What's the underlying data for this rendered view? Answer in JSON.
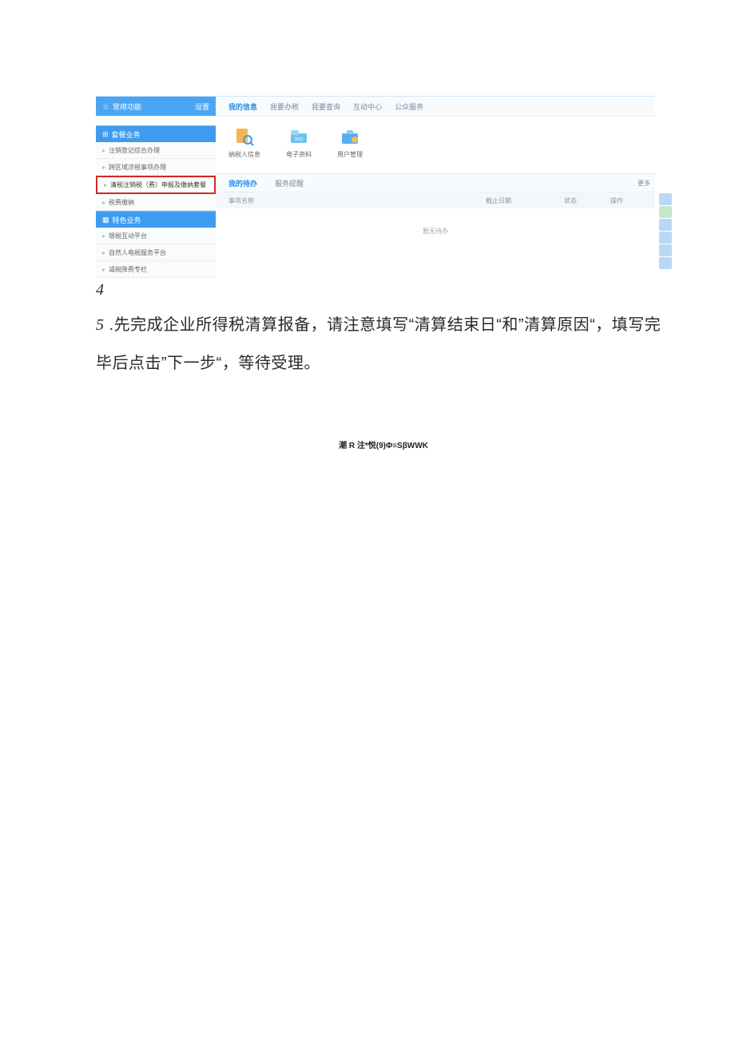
{
  "sidebar": {
    "fav_header": "常用功能",
    "fav_action": "设置",
    "sections": [
      {
        "title": "套餐业务",
        "items": [
          {
            "label": "注销登记综合办理"
          },
          {
            "label": "跨区域涉税事项办理"
          },
          {
            "label": "清税注销税（费）申报及缴纳套餐",
            "highlight": true
          },
          {
            "label": "税费缴纳"
          }
        ]
      },
      {
        "title": "特色业务",
        "items": [
          {
            "label": "银税互动平台"
          },
          {
            "label": "自然人电税服务平台"
          },
          {
            "label": "减税降费专栏"
          }
        ]
      }
    ]
  },
  "tabs": [
    "我的信息",
    "我要办税",
    "我要查询",
    "互动中心",
    "公众服务"
  ],
  "active_tab": 0,
  "info_cards": [
    {
      "label": "纳税人信息"
    },
    {
      "label": "电子资料"
    },
    {
      "label": "用户管理"
    }
  ],
  "subtabs": [
    "我的待办",
    "服务提醒"
  ],
  "active_subtab": 0,
  "subtabs_more": "更多",
  "table": {
    "cols": [
      "事项名称",
      "截止日期",
      "状态",
      "操作"
    ],
    "empty": "暂无待办"
  },
  "doc": {
    "step4": "4",
    "step5_num": "5",
    "step5_text": " .先完成企业所得税清算报备，请注意填写“清算结束日“和”清算原因“，填写完毕后点击”下一步“，等待受理。",
    "footer": "潮 R 注*悦(9)Φ≡SβWWK"
  }
}
